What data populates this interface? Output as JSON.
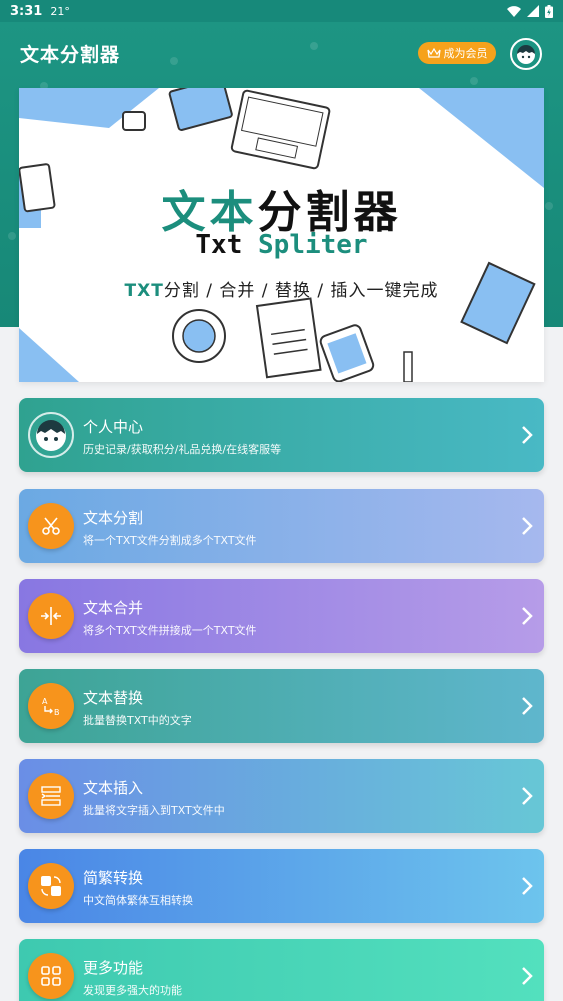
{
  "status_bar": {
    "time": "3:31",
    "temp": "21°"
  },
  "header": {
    "title": "文本分割器",
    "vip_label": "成为会员"
  },
  "banner": {
    "title_part1": "文本",
    "title_part2": "分割器",
    "sub_part1": "Txt ",
    "sub_part2": "Spliter",
    "tagline_part1": "TXT",
    "tagline_part2": "分割 / 合并 / 替换 / 插入一键完成"
  },
  "cards": [
    {
      "title": "个人中心",
      "desc": "历史记录/获取积分/礼品兑换/在线客服等",
      "icon": "avatar-icon"
    },
    {
      "title": "文本分割",
      "desc": "将一个TXT文件分割成多个TXT文件",
      "icon": "scissors-icon"
    },
    {
      "title": "文本合并",
      "desc": "将多个TXT文件拼接成一个TXT文件",
      "icon": "merge-icon"
    },
    {
      "title": "文本替换",
      "desc": "批量替换TXT中的文字",
      "icon": "a-to-b-icon"
    },
    {
      "title": "文本插入",
      "desc": "批量将文字插入到TXT文件中",
      "icon": "insert-text-icon"
    },
    {
      "title": "简繁转换",
      "desc": "中文简体繁体互相转换",
      "icon": "simplified-traditional-icon"
    },
    {
      "title": "更多功能",
      "desc": "发现更多强大的功能",
      "icon": "grid-icon"
    }
  ],
  "colors": {
    "primary": "#178877",
    "accent": "#f7941c"
  }
}
